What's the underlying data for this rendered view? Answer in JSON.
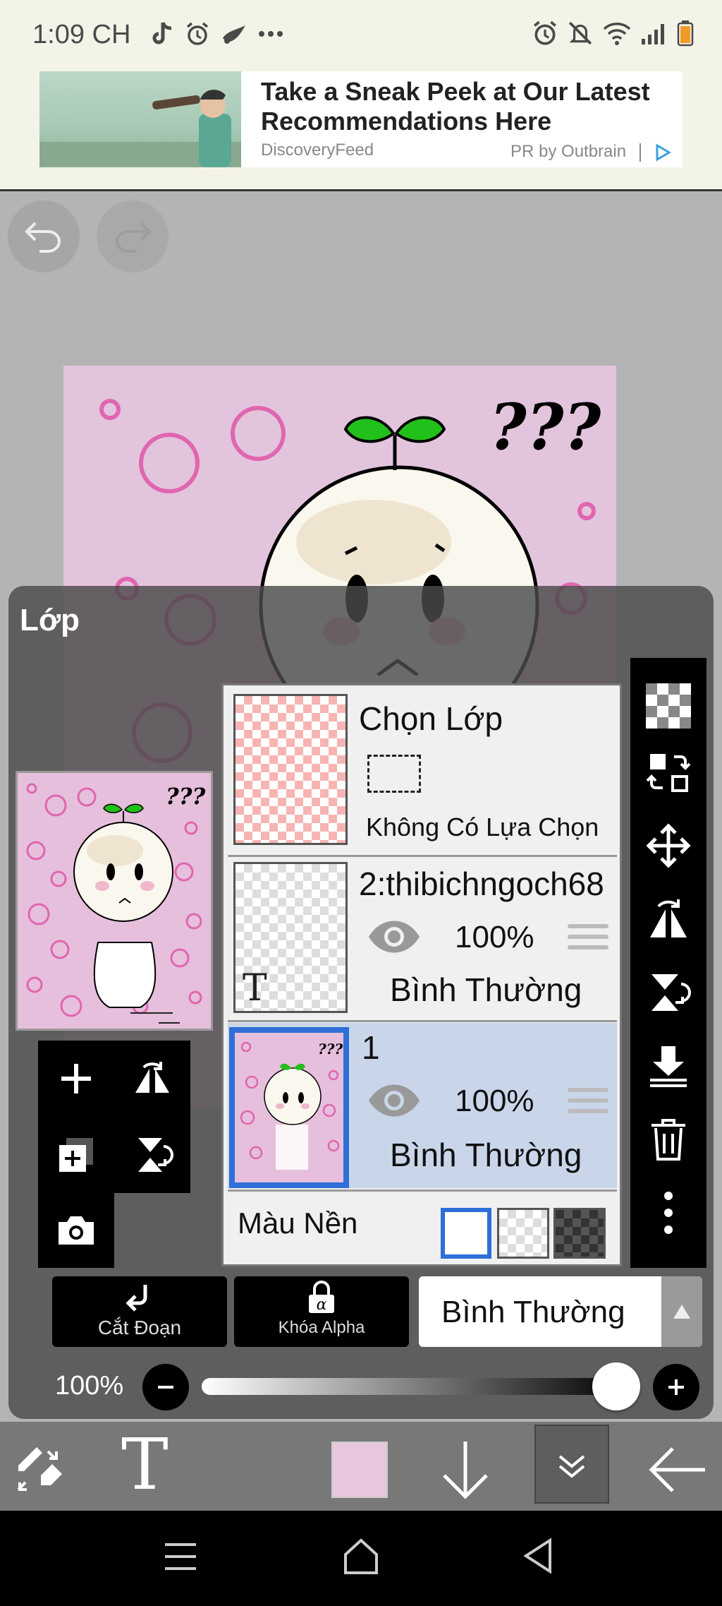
{
  "status_bar": {
    "time": "1:09 CH",
    "left_icons": [
      "tiktok-icon",
      "alarm-icon",
      "app-icon",
      "more-icon"
    ],
    "right_icons": [
      "alarm-icon",
      "mute-icon",
      "wifi-icon",
      "signal-icon",
      "battery-icon"
    ]
  },
  "ad": {
    "title": "Take a Sneak Peek at Our Latest Recommendations Here",
    "source": "DiscoveryFeed",
    "sponsor": "PR by Outbrain"
  },
  "canvas": {
    "artwork_text": "???",
    "colors": {
      "background": "#e3c4dd",
      "bubble": "#e066b0",
      "sprout": "#22c01a"
    }
  },
  "layer_panel": {
    "title": "Lớp",
    "layers": [
      {
        "name": "Chọn Lớp",
        "selection_status": "Không Có Lựa Chọn"
      },
      {
        "name": "2:thibichngoch68",
        "opacity": "100%",
        "blend_mode": "Bình Thường",
        "type_glyph": "T"
      },
      {
        "name": "1",
        "opacity": "100%",
        "blend_mode": "Bình Thường",
        "selected": true
      }
    ],
    "background_label": "Màu Nền",
    "preview_question": "???"
  },
  "controls": {
    "clipping_label": "Cắt Đoạn",
    "alpha_lock_label": "Khóa Alpha",
    "blend_mode": "Bình Thường",
    "opacity": "100%",
    "opacity_level": 1.0
  },
  "bottom_toolbar": {
    "text_tool": "T",
    "current_color": "#e8c6de"
  },
  "colors": {
    "selected_layer_bg": "#c9d6ea",
    "selection_accent": "#2e6fd8",
    "panel_bg": "#4a4a4a"
  }
}
